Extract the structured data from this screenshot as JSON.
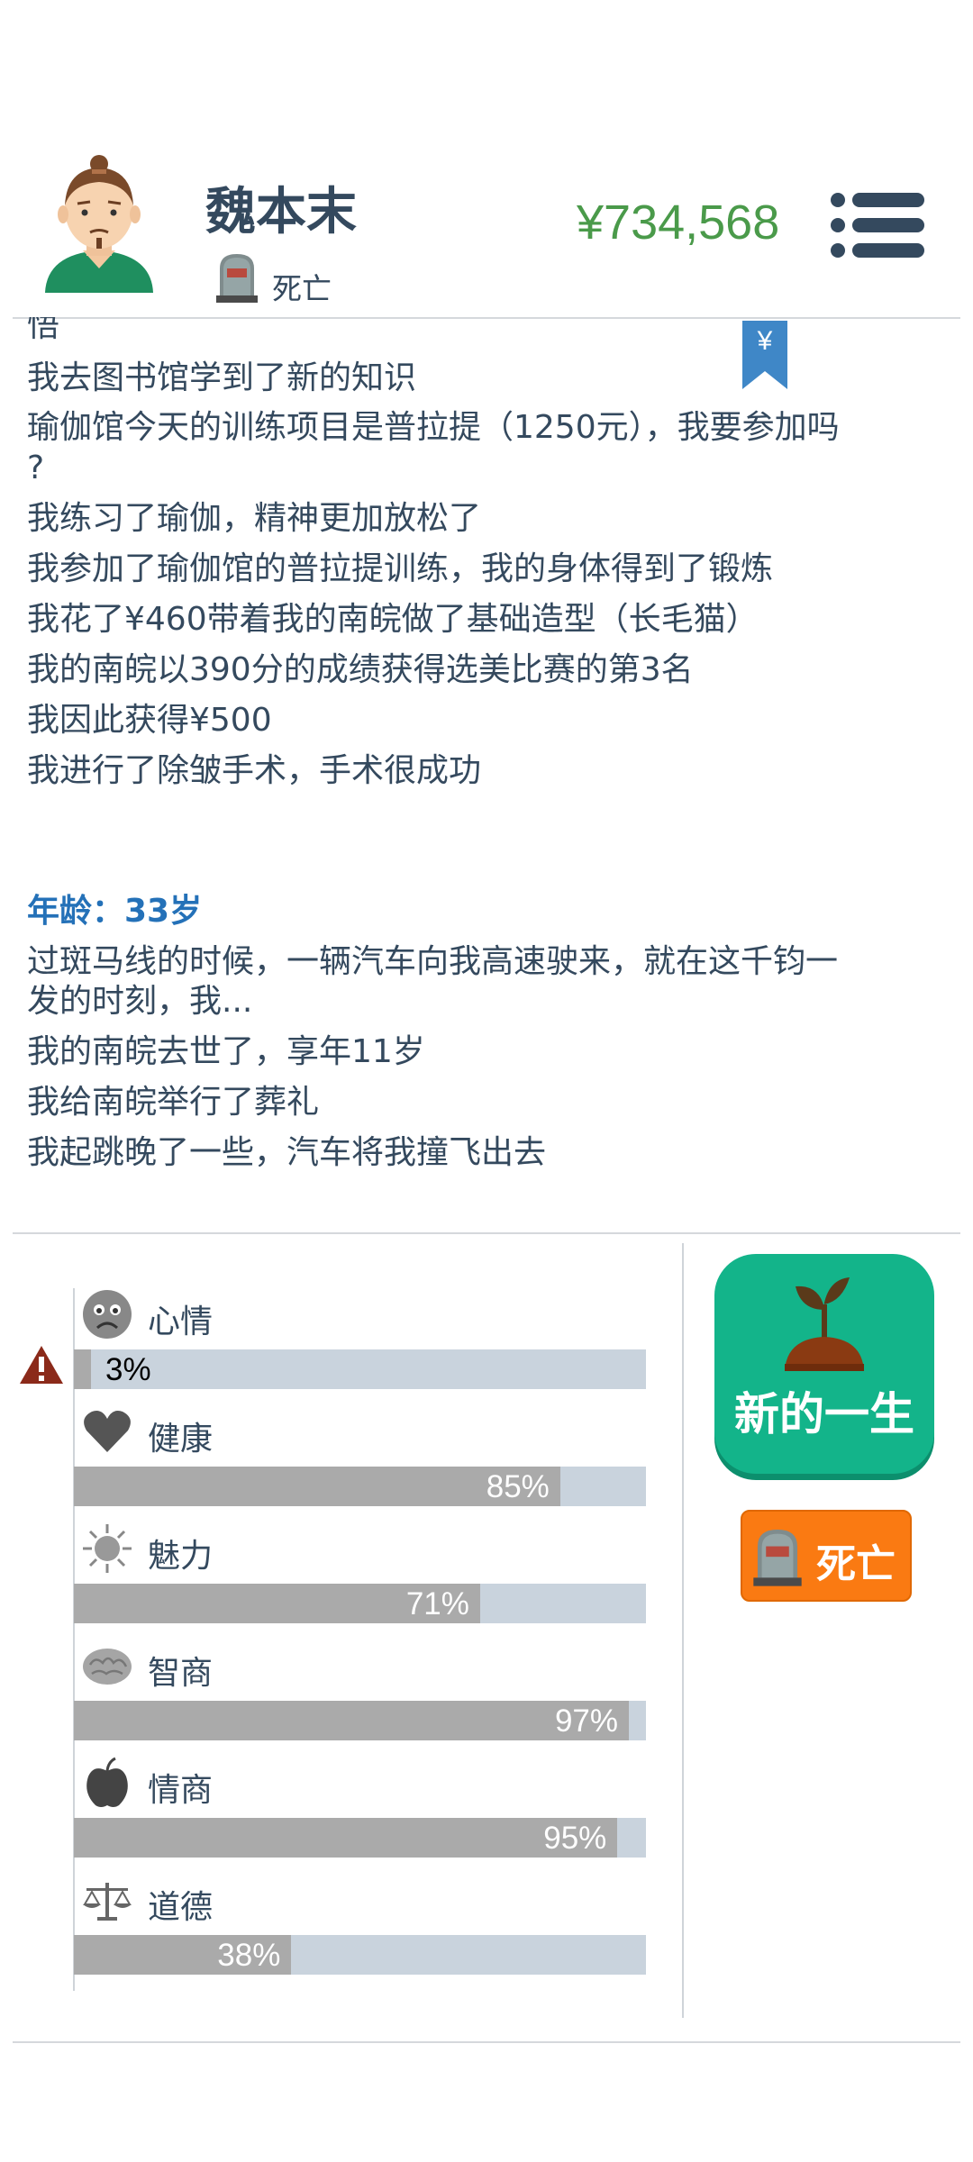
{
  "header": {
    "player_name": "魏本末",
    "status_text": "死亡",
    "money": "¥734,568"
  },
  "log": {
    "bookmark_symbol": "¥",
    "lines": [
      "悟",
      "我去图书馆学到了新的知识",
      "瑜伽馆今天的训练项目是普拉提（1250元），我要参加吗",
      "?",
      "我练习了瑜伽，精神更加放松了",
      "我参加了瑜伽馆的普拉提训练，我的身体得到了锻炼",
      "我花了¥460带着我的南皖做了基础造型（长毛猫）",
      "我的南皖以390分的成绩获得选美比赛的第3名",
      "我因此获得¥500",
      "我进行了除皱手术，手术很成功"
    ],
    "age_heading": "年龄：33岁",
    "age_lines": [
      "过斑马线的时候，一辆汽车向我高速驶来，就在这千钧一",
      "发的时刻，我...",
      "我的南皖去世了，享年11岁",
      "我给南皖举行了葬礼",
      "我起跳晚了一些，汽车将我撞飞出去"
    ]
  },
  "stats": [
    {
      "label": "心情",
      "icon": "sad-face-icon",
      "value": 3,
      "value_text": "3%",
      "warning": true
    },
    {
      "label": "健康",
      "icon": "heart-icon",
      "value": 85,
      "value_text": "85%"
    },
    {
      "label": "魅力",
      "icon": "sun-icon",
      "value": 71,
      "value_text": "71%"
    },
    {
      "label": "智商",
      "icon": "brain-icon",
      "value": 97,
      "value_text": "97%"
    },
    {
      "label": "情商",
      "icon": "apple-icon",
      "value": 95,
      "value_text": "95%"
    },
    {
      "label": "道德",
      "icon": "scales-icon",
      "value": 38,
      "value_text": "38%"
    }
  ],
  "actions": {
    "new_life_label": "新的一生",
    "dead_label": "死亡"
  },
  "colors": {
    "money": "#4a9a4a",
    "age_heading": "#2471b8",
    "bar_fill": "#aaaaaa",
    "bar_track": "#c9d3dd",
    "new_life_button": "#13b48a",
    "dead_button": "#fa7a12"
  }
}
